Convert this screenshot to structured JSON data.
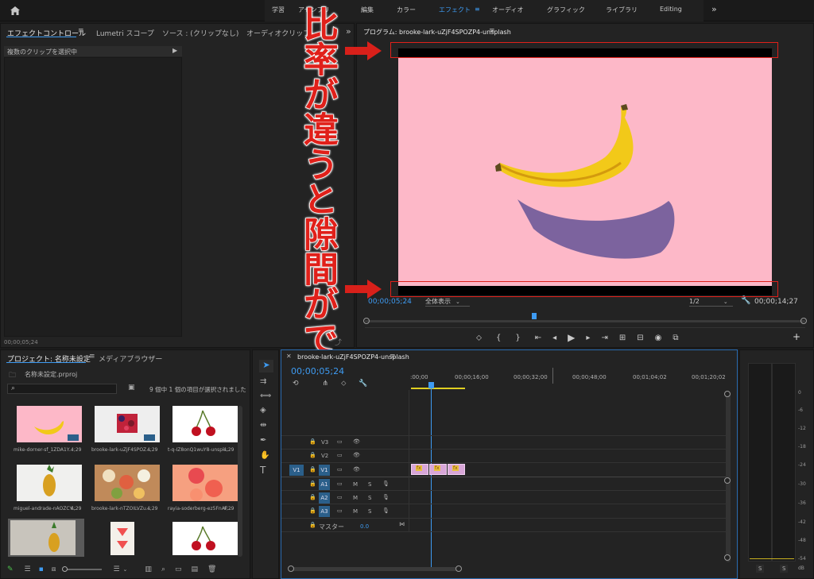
{
  "workspaces": [
    "学習",
    "アセンブリ",
    "編集",
    "カラー",
    "エフェクト",
    "オーディオ",
    "グラフィック",
    "ライブラリ",
    "Editing"
  ],
  "active_workspace": "エフェクト",
  "effect_panel": {
    "tabs": [
      "エフェクトコントロール",
      "Lumetri スコープ",
      "ソース : (クリップなし)",
      "オーディオクリップ"
    ],
    "selection": "複数のクリップを選択中",
    "timecode": "00;00;05;24"
  },
  "program_monitor": {
    "title": "プログラム: brooke-lark-uZjF4SPOZP4-unsplash",
    "timecode": "00;00;05;24",
    "fit": "全体表示",
    "resolution": "1/2",
    "duration": "00;00;14;27"
  },
  "annotation": {
    "text": "比率が違うと隙間ができる",
    "color": "#e0201a"
  },
  "project": {
    "tabs": [
      "プロジェクト: 名称未設定",
      "メディアブラウザー"
    ],
    "file": "名称未設定.prproj",
    "status": "9 個中 1 個の項目が選択されました",
    "items": [
      {
        "name": "mike-dorner-sf_1ZDA1Y...",
        "dur": "4;29"
      },
      {
        "name": "brooke-lark-uZjF4SPOZ...",
        "dur": "4;29"
      },
      {
        "name": "t-q-IZ8onQ1wuY8-unspl...",
        "dur": "4;29"
      },
      {
        "name": "miguel-andrade-nAOZCY...",
        "dur": "4;29"
      },
      {
        "name": "brooke-lark-nTZOILVZu...",
        "dur": "4;29"
      },
      {
        "name": "rayia-soderberg-ez5FnAF...",
        "dur": "4;29"
      }
    ]
  },
  "timeline": {
    "title": "brooke-lark-uZjF4SPOZP4-unsplash",
    "timecode": "00;00;05;24",
    "ruler": [
      ":00;00",
      "00;00;16;00",
      "00;00;32;00",
      "00;00;48;00",
      "00;01;04;02",
      "00;01;20;02"
    ],
    "video_tracks": [
      "V3",
      "V2",
      "V1"
    ],
    "audio_tracks": [
      "A1",
      "A2",
      "A3"
    ],
    "source_patch": "V1",
    "master_label": "マスター",
    "master_value": "0.0",
    "clip_label": "fx"
  },
  "audio_meter": {
    "ticks": [
      "0",
      "-6",
      "-12",
      "-18",
      "-24",
      "-30",
      "-36",
      "-42",
      "-48",
      "-54",
      "dB"
    ],
    "solo": [
      "S",
      "S"
    ]
  }
}
